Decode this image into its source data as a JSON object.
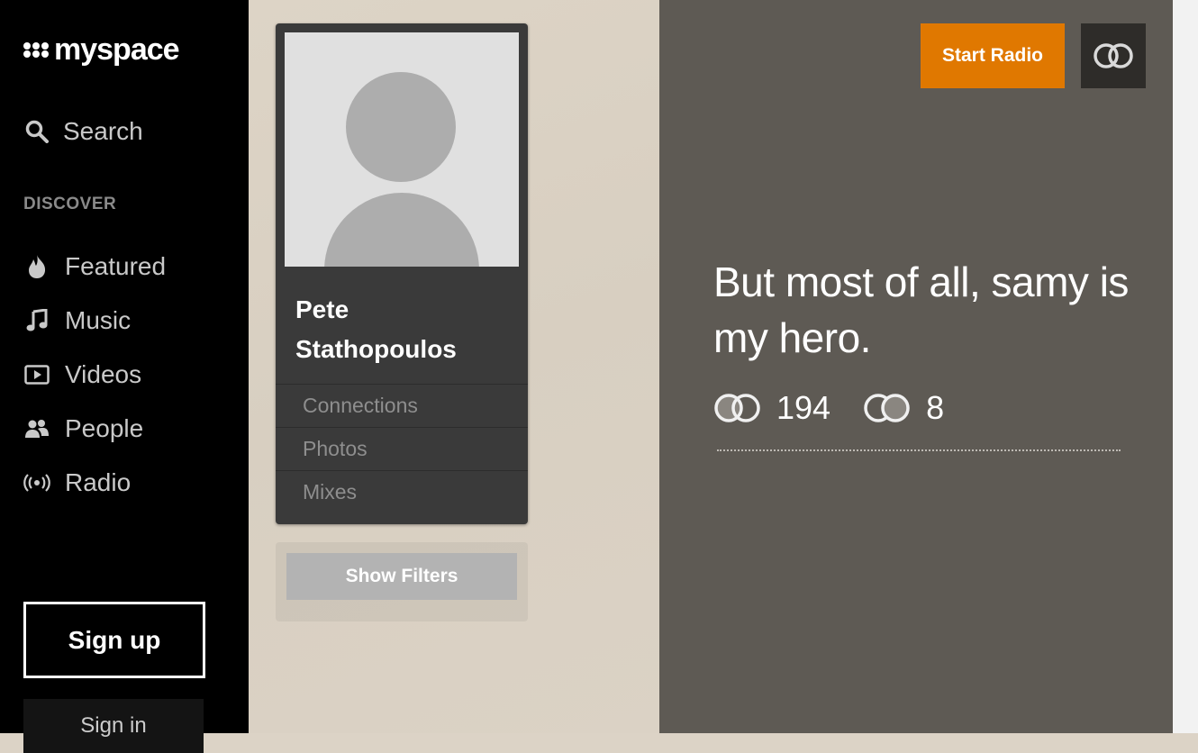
{
  "logo": {
    "text": "myspace"
  },
  "search": {
    "label": "Search",
    "icon": "search-icon"
  },
  "sidebar": {
    "section_title": "DISCOVER",
    "items": [
      {
        "label": "Featured",
        "icon": "flame-icon"
      },
      {
        "label": "Music",
        "icon": "music-note-icon"
      },
      {
        "label": "Videos",
        "icon": "video-icon"
      },
      {
        "label": "People",
        "icon": "people-icon"
      },
      {
        "label": "Radio",
        "icon": "radio-icon"
      }
    ],
    "signup_label": "Sign up",
    "signin_label": "Sign in"
  },
  "profile": {
    "name": "Pete Stathopoulos",
    "links": [
      "Connections",
      "Photos",
      "Mixes"
    ],
    "show_filters_label": "Show Filters"
  },
  "header": {
    "start_radio_label": "Start Radio",
    "connect_icon": "connect-icon"
  },
  "main": {
    "quote": "But most of all, samy is my hero.",
    "stats": [
      {
        "icon": "connections-icon",
        "value": "194"
      },
      {
        "icon": "connections-icon",
        "value": "8"
      }
    ]
  },
  "colors": {
    "accent": "#e07800",
    "sidebar_bg": "#000000",
    "panel_bg": "#5e5a54",
    "card_bg": "#3a3a3a"
  }
}
